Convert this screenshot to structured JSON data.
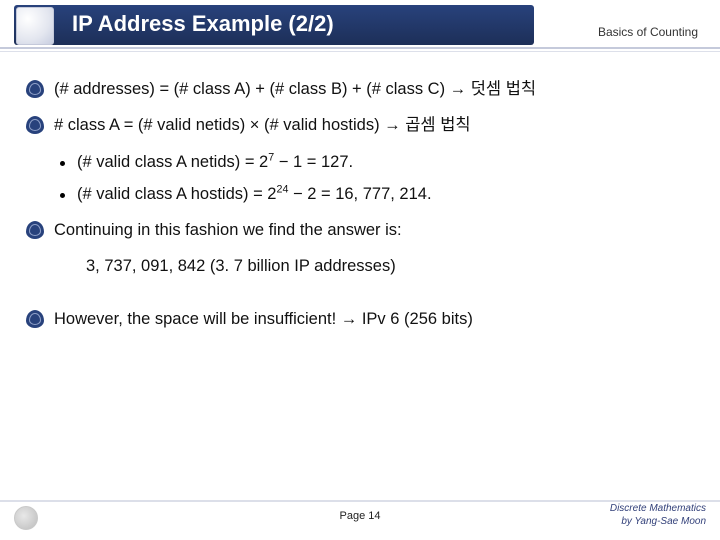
{
  "header": {
    "title": "IP Address Example (2/2)",
    "subtitle": "Basics of Counting"
  },
  "bullets": {
    "line1": "(# addresses) = (# class A) + (# class B) + (# class C)  →  덧셈 법칙",
    "line2": "# class A = (# valid netids) × (# valid hostids)  →  곱셈 법칙",
    "sub1_pre": "(# valid class A netids) = 2",
    "sub1_exp": "7",
    "sub1_post": " − 1 = 127.",
    "sub2_pre": "(# valid class A hostids) = 2",
    "sub2_exp": "24",
    "sub2_post": " − 2 = 16, 777, 214.",
    "line3": "Continuing in this fashion we find the answer is:",
    "line3_answer": "3, 737, 091, 842  (3. 7 billion IP addresses)",
    "line4": "However, the space will be insufficient!  →  IPv 6 (256 bits)"
  },
  "footer": {
    "page": "Page 14",
    "credit1": "Discrete Mathematics",
    "credit2": "by Yang-Sae Moon"
  }
}
